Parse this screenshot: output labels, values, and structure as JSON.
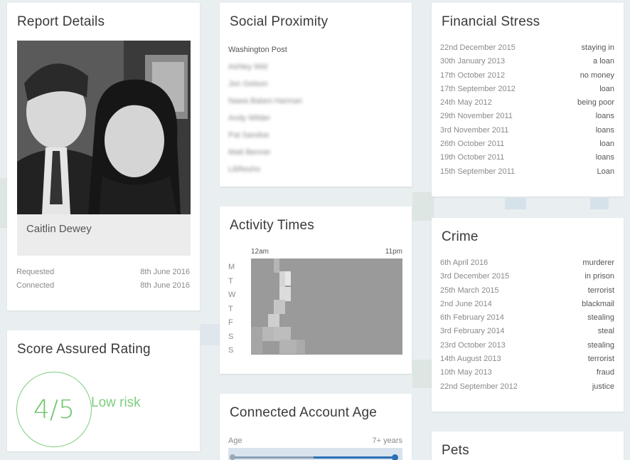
{
  "report": {
    "title": "Report Details",
    "name": "Caitlin Dewey",
    "requested_label": "Requested",
    "requested_date": "8th June 2016",
    "connected_label": "Connected",
    "connected_date": "8th June 2016"
  },
  "score": {
    "title": "Score Assured Rating",
    "value": "4/5",
    "risk": "Low risk"
  },
  "social": {
    "title": "Social Proximity",
    "items": [
      "Washington Post",
      "Ashley Wid",
      "Jon Gelson",
      "Nawa Balani Harman",
      "Andy Wilder",
      "Pat Sandoe",
      "Matt Benner",
      "LiliResho"
    ]
  },
  "activity": {
    "title": "Activity Times",
    "start_label": "12am",
    "end_label": "11pm",
    "days": [
      "M",
      "T",
      "W",
      "T",
      "F",
      "S",
      "S"
    ]
  },
  "age": {
    "title": "Connected Account Age",
    "label": "Age",
    "value": "7+ years"
  },
  "financial": {
    "title": "Financial Stress",
    "rows": [
      {
        "date": "22nd December 2015",
        "term": "staying in"
      },
      {
        "date": "30th January 2013",
        "term": "a loan"
      },
      {
        "date": "17th October 2012",
        "term": "no money"
      },
      {
        "date": "17th September 2012",
        "term": "loan"
      },
      {
        "date": "24th May 2012",
        "term": "being poor"
      },
      {
        "date": "29th November 2011",
        "term": "loans"
      },
      {
        "date": "3rd November 2011",
        "term": "loans"
      },
      {
        "date": "26th October 2011",
        "term": "loan"
      },
      {
        "date": "19th October 2011",
        "term": "loans"
      },
      {
        "date": "15th September 2011",
        "term": "Loan"
      }
    ]
  },
  "crime": {
    "title": "Crime",
    "rows": [
      {
        "date": "6th April 2016",
        "term": "murderer"
      },
      {
        "date": "3rd December 2015",
        "term": "in prison"
      },
      {
        "date": "25th March 2015",
        "term": "terrorist"
      },
      {
        "date": "2nd June 2014",
        "term": "blackmail"
      },
      {
        "date": "6th February 2014",
        "term": "stealing"
      },
      {
        "date": "3rd February 2014",
        "term": "steal"
      },
      {
        "date": "23rd October 2013",
        "term": "stealing"
      },
      {
        "date": "14th August 2013",
        "term": "terrorist"
      },
      {
        "date": "10th May 2013",
        "term": "fraud"
      },
      {
        "date": "22nd September 2012",
        "term": "justice"
      }
    ]
  },
  "pets": {
    "title": "Pets"
  },
  "colors": {
    "accent_green": "#7ccd7c",
    "background": "#e9eef0"
  }
}
